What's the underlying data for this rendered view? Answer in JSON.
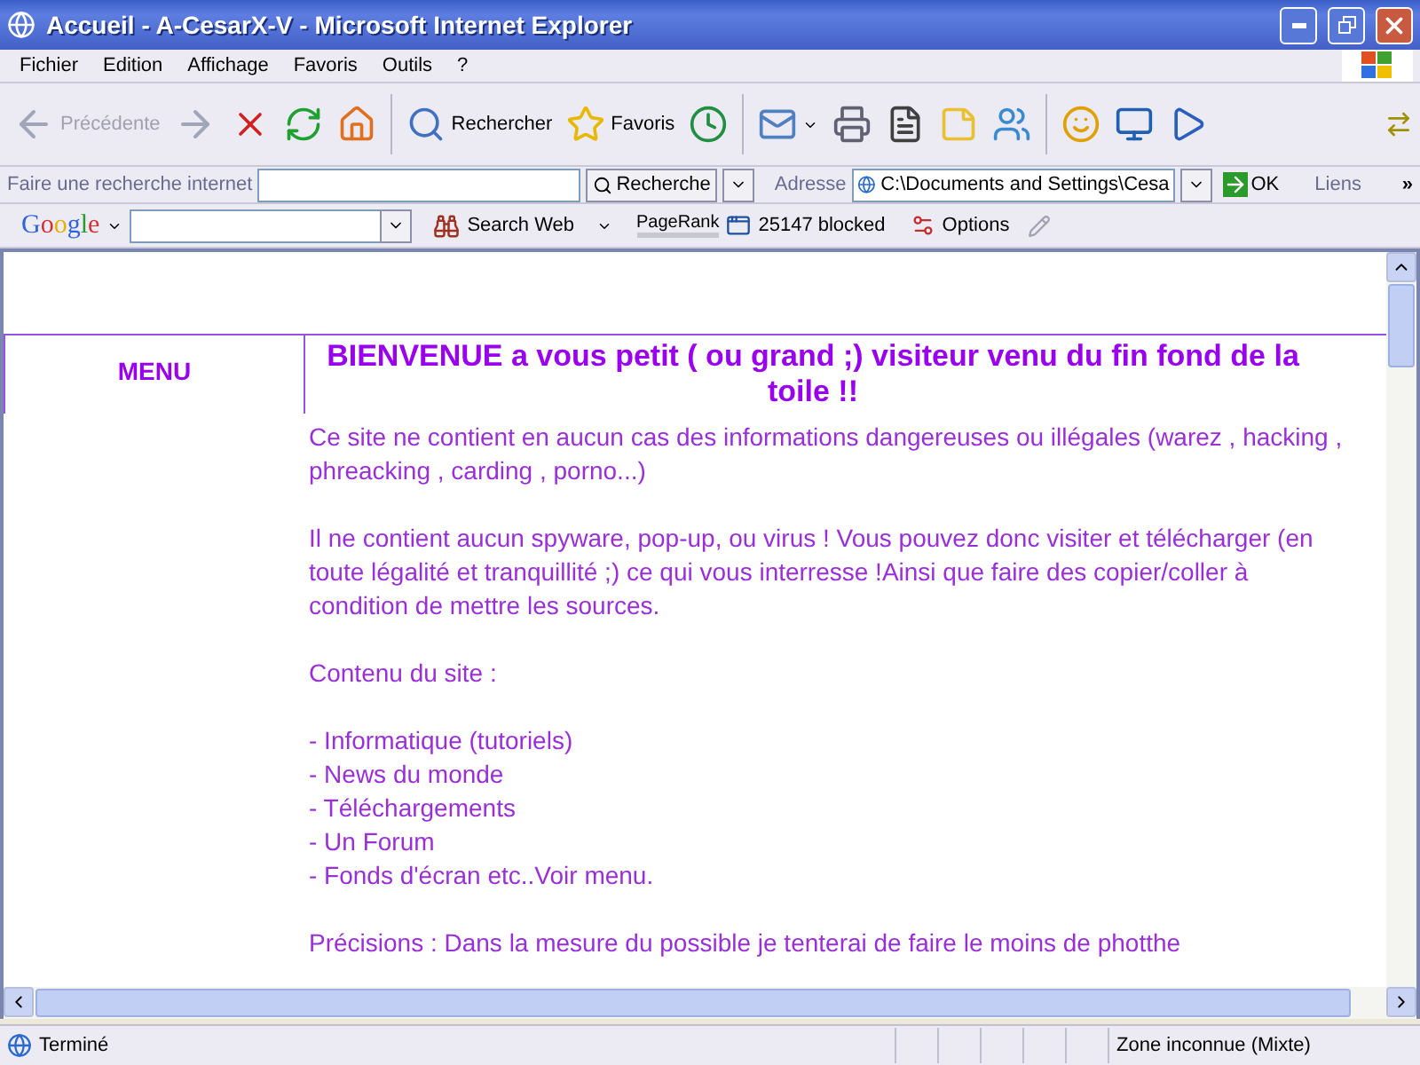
{
  "window": {
    "title": "Accueil - A-CesarX-V - Microsoft Internet Explorer"
  },
  "menu": [
    "Fichier",
    "Edition",
    "Affichage",
    "Favoris",
    "Outils",
    "?"
  ],
  "toolbar": [
    {
      "kind": "back",
      "label": "Précédente",
      "disabled": true
    },
    {
      "kind": "forward",
      "disabled": true
    },
    {
      "kind": "stop",
      "disabled": false
    },
    {
      "kind": "refresh",
      "disabled": false
    },
    {
      "kind": "home",
      "disabled": false
    },
    {
      "kind": "search",
      "label": "Rechercher",
      "disabled": false
    },
    {
      "kind": "favorites",
      "label": "Favoris",
      "disabled": false
    },
    {
      "kind": "history",
      "disabled": false
    },
    {
      "kind": "mail",
      "disabled": false
    },
    {
      "kind": "print",
      "disabled": false
    },
    {
      "kind": "word",
      "disabled": false
    },
    {
      "kind": "note",
      "disabled": false
    },
    {
      "kind": "messenger",
      "disabled": false
    },
    {
      "kind": "smiley",
      "disabled": false
    },
    {
      "kind": "monitor",
      "disabled": false
    },
    {
      "kind": "play",
      "disabled": false
    }
  ],
  "address_bar": {
    "search_label": "Faire une recherche internet",
    "search_button": "Recherche",
    "address_label": "Adresse",
    "address": "C:\\Documents and Settings\\Cesa",
    "go": "OK",
    "links": "Liens",
    "more": "»"
  },
  "google_bar": {
    "logo": "Google",
    "search_web": "Search Web",
    "pagerank": "PageRank",
    "blocked": "25147 blocked",
    "options": "Options"
  },
  "page": {
    "menu_label": "MENU",
    "heading": "BIENVENUE a vous petit ( ou grand ;) visiteur venu du fin fond de la toile !!",
    "blocks": [
      {
        "kind": "paragraph",
        "text": "Ce site ne contient en aucun cas des informations dangereuses ou illégales (warez , hacking , phreacking , carding , porno...)"
      },
      {
        "kind": "paragraph",
        "text": "Il ne contient aucun spyware, pop-up, ou virus ! Vous pouvez donc visiter et télécharger (en toute légalité et tranquillité ;) ce qui vous interresse !Ainsi que faire des copier/coller à condition de mettre les sources."
      },
      {
        "kind": "paragraph",
        "text": "Contenu du site :"
      },
      {
        "kind": "list",
        "items": [
          "- Informatique (tutoriels)",
          "- News du monde",
          "- Téléchargements",
          "- Un Forum",
          "- Fonds d'écran etc..Voir menu."
        ]
      },
      {
        "kind": "paragraph",
        "text": "Précisions : Dans la mesure du possible je tenterai de faire le moins de photthe"
      }
    ]
  },
  "status_bar": {
    "text": "Terminé",
    "zone": "Zone inconnue (Mixte)"
  }
}
